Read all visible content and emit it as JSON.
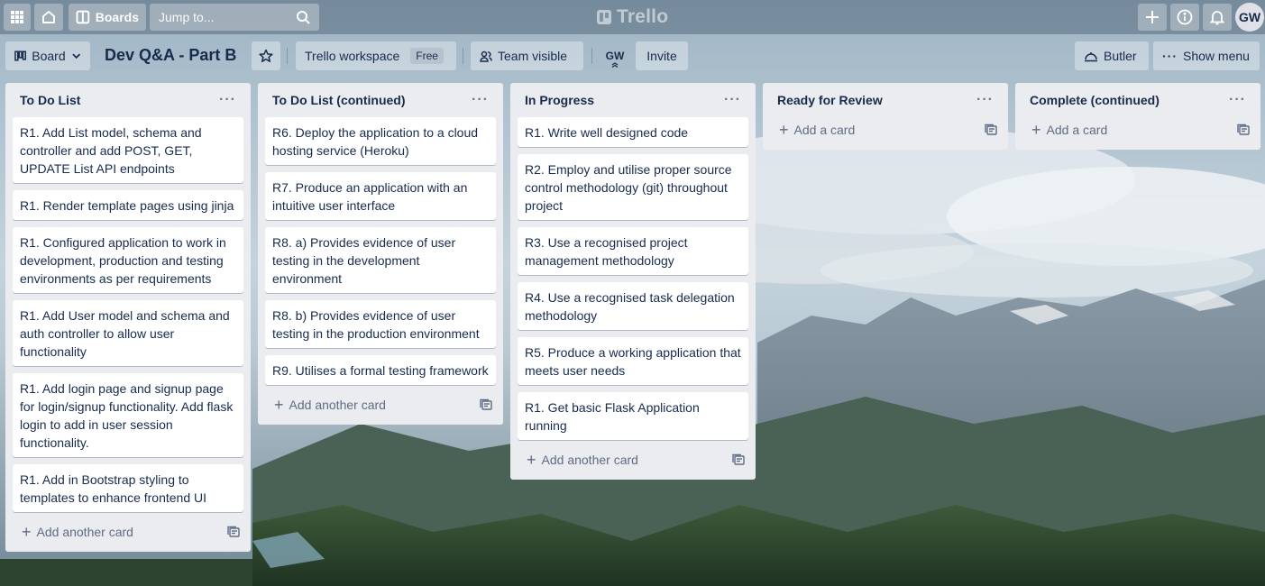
{
  "topnav": {
    "boards_label": "Boards",
    "search_placeholder": "Jump to...",
    "logo_text": "Trello",
    "avatar_initials": "GW"
  },
  "board_header": {
    "view_label": "Board",
    "title": "Dev Q&A - Part B",
    "workspace_label": "Trello workspace",
    "workspace_badge": "Free",
    "visibility_label": "Team visible",
    "member_initials": "GW",
    "invite_label": "Invite",
    "butler_label": "Butler",
    "show_menu_label": "Show menu"
  },
  "lists": [
    {
      "title": "To Do List",
      "cards": [
        "R1. Add List model, schema and controller and add POST, GET, UPDATE List API endpoints",
        "R1. Render template pages using jinja",
        "R1. Configured application to work in development, production and testing environments as per requirements",
        "R1. Add User model and schema and auth controller to allow user functionality",
        "R1. Add login page and signup page for login/signup functionality. Add flask login to add in user session functionality.",
        "R1. Add in Bootstrap styling to templates to enhance frontend UI"
      ],
      "add_label": "Add another card"
    },
    {
      "title": "To Do List (continued)",
      "cards": [
        "R6. Deploy the application to a cloud hosting service (Heroku)",
        "R7. Produce an application with an intuitive user interface",
        "R8. a) Provides evidence of user testing in the development environment",
        "R8. b) Provides evidence of user testing in the production environment",
        "R9. Utilises a formal testing framework"
      ],
      "add_label": "Add another card"
    },
    {
      "title": "In Progress",
      "cards": [
        "R1. Write well designed code",
        "R2. Employ and utilise proper source control methodology (git) throughout project",
        "R3. Use a recognised project management methodology",
        "R4. Use a recognised task delegation methodology",
        "R5. Produce a working application that meets user needs",
        "R1. Get basic Flask Application running"
      ],
      "add_label": "Add another card"
    },
    {
      "title": "Ready for Review",
      "cards": [],
      "add_label": "Add a card"
    },
    {
      "title": "Complete (continued)",
      "cards": [],
      "add_label": "Add a card"
    }
  ],
  "colors": {
    "list_bg": "#ebecf0",
    "text": "#172b4d",
    "muted": "#5e6c84"
  }
}
